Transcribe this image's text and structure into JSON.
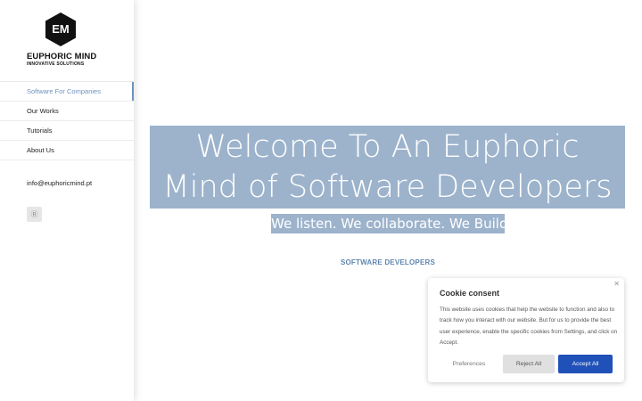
{
  "brand": {
    "monogram": "EM",
    "name": "EUPHORIC MIND",
    "tagline": "INNOVATIVE SOLUTIONS",
    "accent": "#6e93bd"
  },
  "sidebar": {
    "items": [
      {
        "label": "Software For Companies",
        "active": true
      },
      {
        "label": "Our Works",
        "active": false
      },
      {
        "label": "Tutorials",
        "active": false
      },
      {
        "label": "About Us",
        "active": false
      }
    ],
    "email": "info@euphoricmind.pt",
    "social_icon": "skype-icon"
  },
  "hero": {
    "title_line1": "Welcome To An Euphoric",
    "title_line2": "Mind of Software Developers",
    "subtitle": "We listen. We collaborate. We Build.",
    "section_label": "SOFTWARE DEVELOPERS",
    "highlight_color": "#9db3cc"
  },
  "cookie": {
    "title": "Cookie consent",
    "text": "This website uses cookies that help the website to function and also to track how you interact with our website. But for us to provide the best user experience, enable the specific cookies from Settings, and click on Accept.",
    "preferences_label": "Preferences",
    "reject_label": "Reject All",
    "accept_label": "Accept All",
    "close_icon": "close-icon",
    "accept_color": "#1f51b8"
  }
}
